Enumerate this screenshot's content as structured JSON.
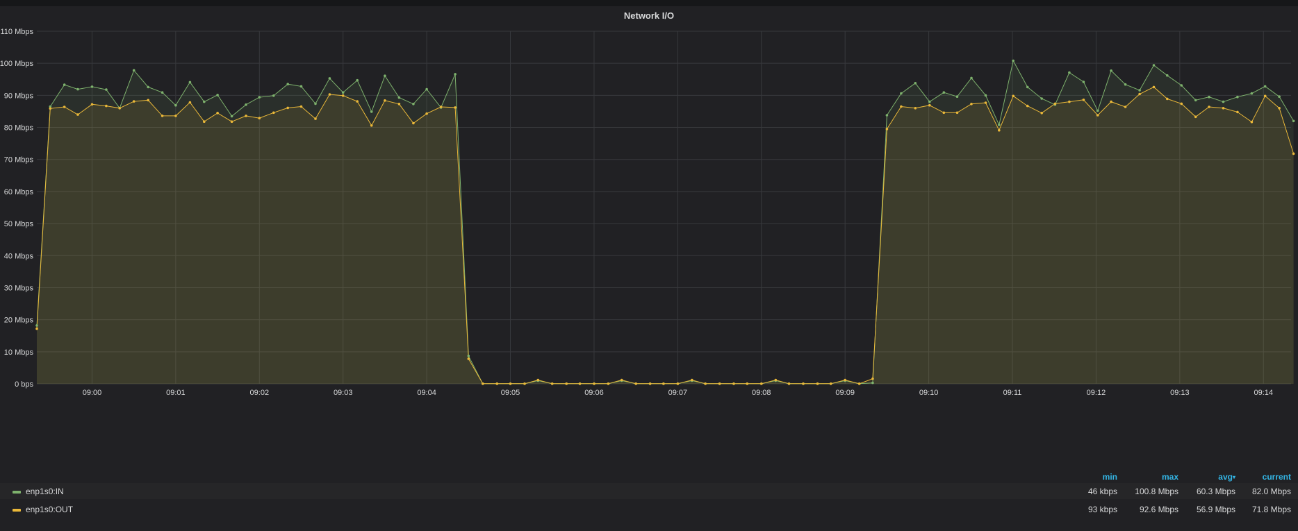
{
  "panel": {
    "title": "Network I/O"
  },
  "legend": {
    "headers": {
      "min": "min",
      "max": "max",
      "avg": "avg",
      "current": "current",
      "sort_indicator": "▾"
    },
    "rows": [
      {
        "name": "enp1s0:IN",
        "color": "#7eb26d",
        "min": "46 kbps",
        "max": "100.8 Mbps",
        "avg": "60.3 Mbps",
        "current": "82.0 Mbps"
      },
      {
        "name": "enp1s0:OUT",
        "color": "#eab839",
        "min": "93 kbps",
        "max": "92.6 Mbps",
        "avg": "56.9 Mbps",
        "current": "71.8 Mbps"
      }
    ]
  },
  "chart_data": {
    "type": "area",
    "title": "Network I/O",
    "x_unit": "minutes since 09:00",
    "xlim": [
      -0.66,
      14.33
    ],
    "ylim": [
      0,
      110
    ],
    "y_unit": "Mbps",
    "y_ticks": [
      {
        "value": 0,
        "label": "0 bps"
      },
      {
        "value": 10,
        "label": "10 Mbps"
      },
      {
        "value": 20,
        "label": "20 Mbps"
      },
      {
        "value": 30,
        "label": "30 Mbps"
      },
      {
        "value": 40,
        "label": "40 Mbps"
      },
      {
        "value": 50,
        "label": "50 Mbps"
      },
      {
        "value": 60,
        "label": "60 Mbps"
      },
      {
        "value": 70,
        "label": "70 Mbps"
      },
      {
        "value": 80,
        "label": "80 Mbps"
      },
      {
        "value": 90,
        "label": "90 Mbps"
      },
      {
        "value": 100,
        "label": "100 Mbps"
      },
      {
        "value": 110,
        "label": "110 Mbps"
      }
    ],
    "x_ticks": [
      {
        "value": 0,
        "label": "09:00"
      },
      {
        "value": 1,
        "label": "09:01"
      },
      {
        "value": 2,
        "label": "09:02"
      },
      {
        "value": 3,
        "label": "09:03"
      },
      {
        "value": 4,
        "label": "09:04"
      },
      {
        "value": 5,
        "label": "09:05"
      },
      {
        "value": 6,
        "label": "09:06"
      },
      {
        "value": 7,
        "label": "09:07"
      },
      {
        "value": 8,
        "label": "09:08"
      },
      {
        "value": 9,
        "label": "09:09"
      },
      {
        "value": 10,
        "label": "09:10"
      },
      {
        "value": 11,
        "label": "09:11"
      },
      {
        "value": 12,
        "label": "09:12"
      },
      {
        "value": 13,
        "label": "09:13"
      },
      {
        "value": 14,
        "label": "09:14"
      }
    ],
    "grid": true,
    "legend_position": "bottom",
    "series": [
      {
        "name": "enp1s0:IN",
        "color": "#7eb26d",
        "points": [
          [
            -0.66,
            18.2
          ],
          [
            -0.5,
            86.5
          ],
          [
            -0.33,
            93.3
          ],
          [
            -0.17,
            91.9
          ],
          [
            0.0,
            92.7
          ],
          [
            0.17,
            91.8
          ],
          [
            0.33,
            86.0
          ],
          [
            0.5,
            97.8
          ],
          [
            0.67,
            92.6
          ],
          [
            0.84,
            90.9
          ],
          [
            1.0,
            86.9
          ],
          [
            1.17,
            94.1
          ],
          [
            1.34,
            88.0
          ],
          [
            1.5,
            90.1
          ],
          [
            1.67,
            83.5
          ],
          [
            1.84,
            87.1
          ],
          [
            2.0,
            89.4
          ],
          [
            2.17,
            89.9
          ],
          [
            2.34,
            93.5
          ],
          [
            2.5,
            92.8
          ],
          [
            2.67,
            87.4
          ],
          [
            2.84,
            95.3
          ],
          [
            3.0,
            90.9
          ],
          [
            3.17,
            94.7
          ],
          [
            3.34,
            84.9
          ],
          [
            3.5,
            96.1
          ],
          [
            3.67,
            89.3
          ],
          [
            3.84,
            87.3
          ],
          [
            4.0,
            91.9
          ],
          [
            4.17,
            86.2
          ],
          [
            4.34,
            96.6
          ],
          [
            4.5,
            8.7
          ],
          [
            4.67,
            0.05
          ],
          [
            4.84,
            0.05
          ],
          [
            5.0,
            0.05
          ],
          [
            5.17,
            0.05
          ],
          [
            5.33,
            1.0
          ],
          [
            5.5,
            0.05
          ],
          [
            5.67,
            0.05
          ],
          [
            5.83,
            0.05
          ],
          [
            6.0,
            0.05
          ],
          [
            6.17,
            0.05
          ],
          [
            6.33,
            1.0
          ],
          [
            6.5,
            0.05
          ],
          [
            6.67,
            0.05
          ],
          [
            6.83,
            0.05
          ],
          [
            7.0,
            0.05
          ],
          [
            7.17,
            1.0
          ],
          [
            7.33,
            0.05
          ],
          [
            7.5,
            0.05
          ],
          [
            7.67,
            0.05
          ],
          [
            7.83,
            0.05
          ],
          [
            8.0,
            0.05
          ],
          [
            8.17,
            1.0
          ],
          [
            8.33,
            0.05
          ],
          [
            8.5,
            0.05
          ],
          [
            8.67,
            0.05
          ],
          [
            8.83,
            0.05
          ],
          [
            9.0,
            1.0
          ],
          [
            9.17,
            0.05
          ],
          [
            9.33,
            0.3
          ],
          [
            9.5,
            83.8
          ],
          [
            9.67,
            90.6
          ],
          [
            9.84,
            93.8
          ],
          [
            10.01,
            88.0
          ],
          [
            10.18,
            90.9
          ],
          [
            10.34,
            89.6
          ],
          [
            10.51,
            95.4
          ],
          [
            10.68,
            90.0
          ],
          [
            10.84,
            80.8
          ],
          [
            11.01,
            100.8
          ],
          [
            11.18,
            92.6
          ],
          [
            11.35,
            89.0
          ],
          [
            11.51,
            87.1
          ],
          [
            11.68,
            97.1
          ],
          [
            11.85,
            94.2
          ],
          [
            12.02,
            85.2
          ],
          [
            12.18,
            97.7
          ],
          [
            12.35,
            93.4
          ],
          [
            12.52,
            91.6
          ],
          [
            12.69,
            99.4
          ],
          [
            12.85,
            96.2
          ],
          [
            13.02,
            93.1
          ],
          [
            13.19,
            88.5
          ],
          [
            13.35,
            89.5
          ],
          [
            13.52,
            88.0
          ],
          [
            13.69,
            89.5
          ],
          [
            13.86,
            90.6
          ],
          [
            14.02,
            92.8
          ],
          [
            14.19,
            89.6
          ],
          [
            14.36,
            82.0
          ]
        ]
      },
      {
        "name": "enp1s0:OUT",
        "color": "#eab839",
        "points": [
          [
            -0.66,
            17.2
          ],
          [
            -0.5,
            85.9
          ],
          [
            -0.33,
            86.4
          ],
          [
            -0.17,
            84.0
          ],
          [
            0.0,
            87.2
          ],
          [
            0.17,
            86.7
          ],
          [
            0.33,
            86.0
          ],
          [
            0.5,
            88.1
          ],
          [
            0.67,
            88.5
          ],
          [
            0.84,
            83.6
          ],
          [
            1.0,
            83.6
          ],
          [
            1.17,
            87.8
          ],
          [
            1.34,
            81.8
          ],
          [
            1.5,
            84.5
          ],
          [
            1.67,
            81.8
          ],
          [
            1.84,
            83.6
          ],
          [
            2.0,
            82.9
          ],
          [
            2.17,
            84.6
          ],
          [
            2.34,
            86.1
          ],
          [
            2.5,
            86.5
          ],
          [
            2.67,
            82.7
          ],
          [
            2.84,
            90.3
          ],
          [
            3.0,
            89.9
          ],
          [
            3.17,
            88.1
          ],
          [
            3.34,
            80.6
          ],
          [
            3.5,
            88.4
          ],
          [
            3.67,
            87.3
          ],
          [
            3.84,
            81.3
          ],
          [
            4.0,
            84.3
          ],
          [
            4.17,
            86.4
          ],
          [
            4.34,
            86.2
          ],
          [
            4.5,
            7.8
          ],
          [
            4.67,
            0.05
          ],
          [
            4.84,
            0.05
          ],
          [
            5.0,
            0.05
          ],
          [
            5.17,
            0.05
          ],
          [
            5.33,
            1.2
          ],
          [
            5.5,
            0.05
          ],
          [
            5.67,
            0.05
          ],
          [
            5.83,
            0.05
          ],
          [
            6.0,
            0.05
          ],
          [
            6.17,
            0.05
          ],
          [
            6.33,
            1.2
          ],
          [
            6.5,
            0.05
          ],
          [
            6.67,
            0.05
          ],
          [
            6.83,
            0.05
          ],
          [
            7.0,
            0.05
          ],
          [
            7.17,
            1.2
          ],
          [
            7.33,
            0.05
          ],
          [
            7.5,
            0.05
          ],
          [
            7.67,
            0.05
          ],
          [
            7.83,
            0.05
          ],
          [
            8.0,
            0.05
          ],
          [
            8.17,
            1.2
          ],
          [
            8.33,
            0.05
          ],
          [
            8.5,
            0.05
          ],
          [
            8.67,
            0.05
          ],
          [
            8.83,
            0.05
          ],
          [
            9.0,
            1.2
          ],
          [
            9.17,
            0.05
          ],
          [
            9.33,
            1.6
          ],
          [
            9.5,
            79.5
          ],
          [
            9.67,
            86.5
          ],
          [
            9.84,
            86.0
          ],
          [
            10.01,
            86.9
          ],
          [
            10.18,
            84.6
          ],
          [
            10.34,
            84.6
          ],
          [
            10.51,
            87.3
          ],
          [
            10.68,
            87.7
          ],
          [
            10.84,
            79.1
          ],
          [
            11.01,
            89.8
          ],
          [
            11.18,
            86.7
          ],
          [
            11.35,
            84.5
          ],
          [
            11.51,
            87.4
          ],
          [
            11.68,
            88.0
          ],
          [
            11.85,
            88.6
          ],
          [
            12.02,
            83.8
          ],
          [
            12.18,
            88.0
          ],
          [
            12.35,
            86.4
          ],
          [
            12.52,
            90.4
          ],
          [
            12.69,
            92.6
          ],
          [
            12.85,
            88.9
          ],
          [
            13.02,
            87.4
          ],
          [
            13.19,
            83.3
          ],
          [
            13.35,
            86.4
          ],
          [
            13.52,
            86.0
          ],
          [
            13.69,
            84.8
          ],
          [
            13.86,
            81.7
          ],
          [
            14.02,
            89.8
          ],
          [
            14.19,
            86.0
          ],
          [
            14.36,
            71.8
          ]
        ]
      }
    ]
  }
}
